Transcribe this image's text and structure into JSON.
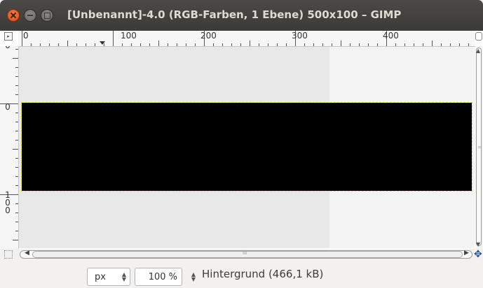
{
  "window": {
    "title": "[Unbenannt]-4.0 (RGB-Farben, 1 Ebene) 500x100 – GIMP",
    "close_icon": "close-icon",
    "minimize_icon": "minimize-icon",
    "maximize_icon": "maximize-icon"
  },
  "rulers": {
    "horizontal_labels": [
      "0",
      "100",
      "200",
      "300",
      "400"
    ],
    "vertical_labels": [
      {
        "text": "0",
        "vertical": false
      },
      {
        "text": "0",
        "vertical": false
      },
      {
        "text": "100",
        "vertical": true
      }
    ]
  },
  "canvas": {
    "image_color": "#000000",
    "boundary_color": "#e8e800"
  },
  "scrollbars": {
    "vertical_grip": "=",
    "horizontal_grip": "III",
    "left_arrow": "◀",
    "right_arrow": "▶",
    "up_arrow": "▲",
    "down_arrow": "▼"
  },
  "statusbar": {
    "unit": "px",
    "zoom": "100 %",
    "layer_info": "Hintergrund (466,1 kB)"
  },
  "icons": {
    "navigate": "✥",
    "quickmask": "quickmask-icon",
    "nav_toggle": "menu-icon",
    "zoom_toggle": "zoom-icon"
  }
}
